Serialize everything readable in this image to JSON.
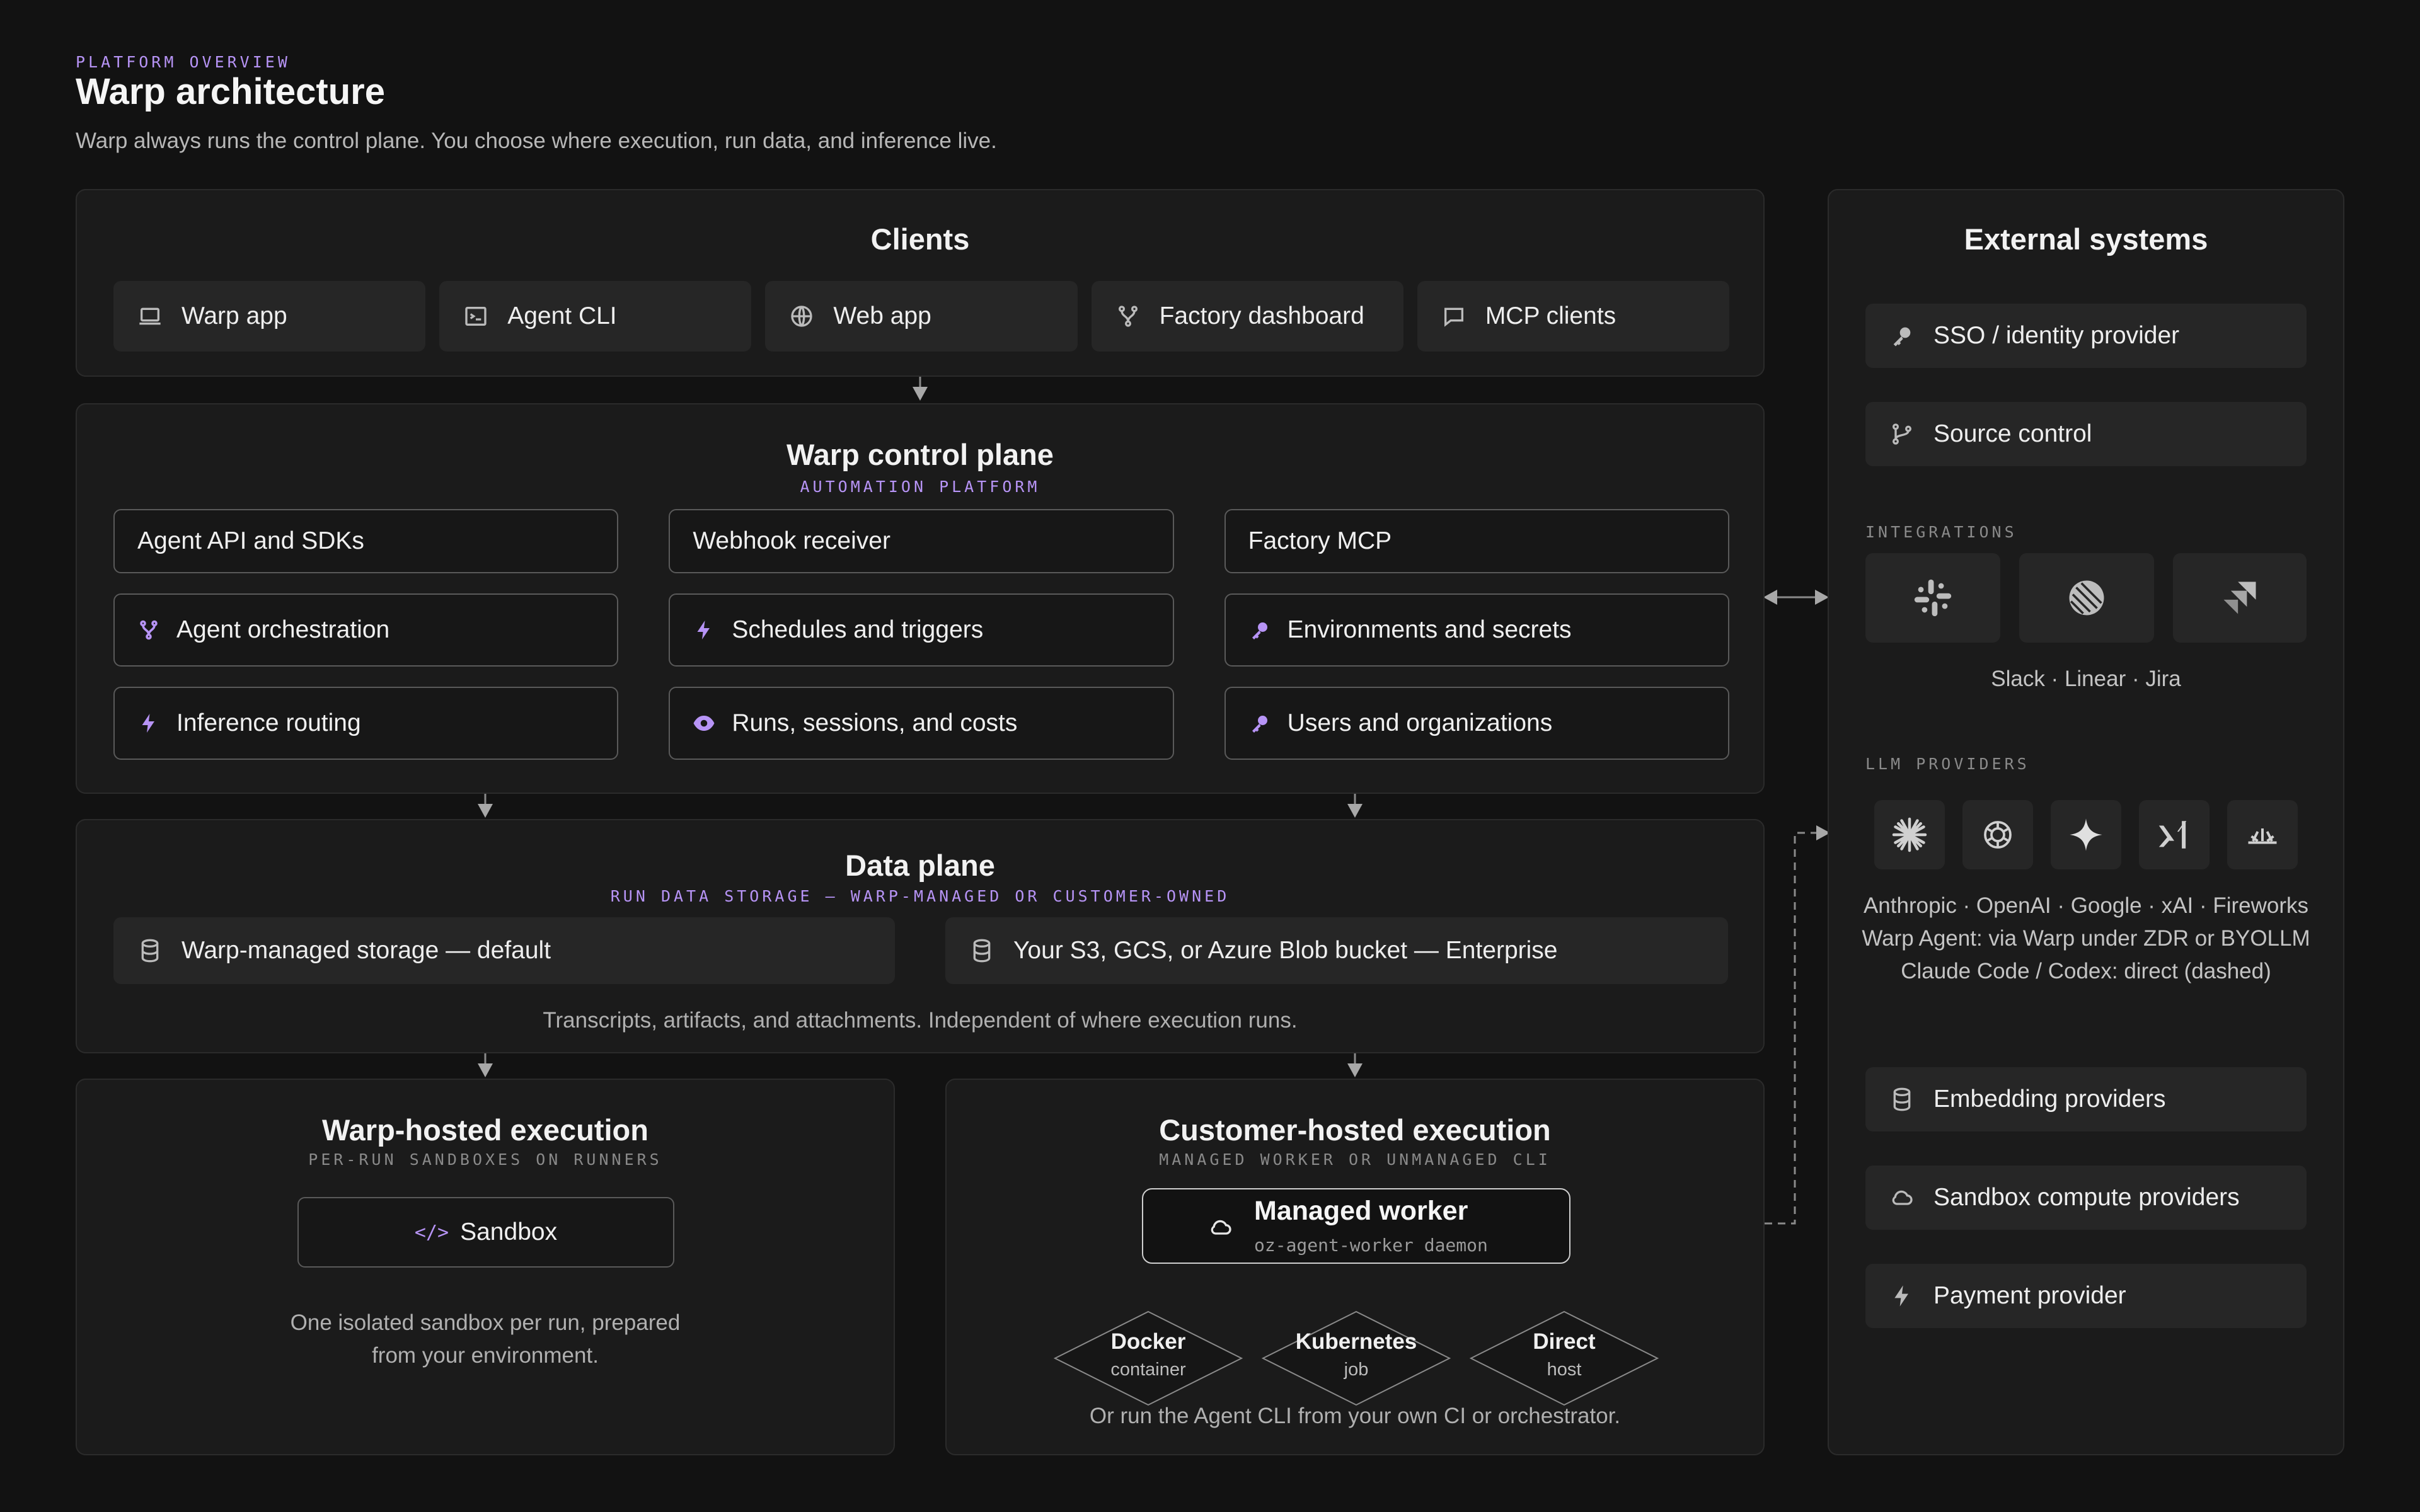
{
  "header": {
    "eyebrow": "PLATFORM OVERVIEW",
    "title": "Warp architecture",
    "subtitle": "Warp always runs the control plane. You choose where execution, run data, and inference live."
  },
  "clients": {
    "title": "Clients",
    "items": [
      {
        "label": "Warp app",
        "icon": "laptop-icon"
      },
      {
        "label": "Agent CLI",
        "icon": "terminal-icon"
      },
      {
        "label": "Web app",
        "icon": "globe-icon"
      },
      {
        "label": "Factory dashboard",
        "icon": "git-fork-icon"
      },
      {
        "label": "MCP clients",
        "icon": "chat-icon"
      }
    ]
  },
  "control_plane": {
    "title": "Warp control plane",
    "subtitle": "AUTOMATION PLATFORM",
    "items": [
      {
        "label": "Agent API and SDKs",
        "icon": ""
      },
      {
        "label": "Webhook receiver",
        "icon": ""
      },
      {
        "label": "Factory MCP",
        "icon": ""
      },
      {
        "label": "Agent orchestration",
        "icon": "git-fork-icon"
      },
      {
        "label": "Schedules and triggers",
        "icon": "bolt-icon"
      },
      {
        "label": "Environments and secrets",
        "icon": "key-icon"
      },
      {
        "label": "Inference routing",
        "icon": "bolt-icon"
      },
      {
        "label": "Runs, sessions, and costs",
        "icon": "eye-icon"
      },
      {
        "label": "Users and organizations",
        "icon": "key-icon"
      }
    ]
  },
  "data_plane": {
    "title": "Data plane",
    "subtitle": "RUN DATA STORAGE — WARP-MANAGED OR CUSTOMER-OWNED",
    "items": [
      {
        "label": "Warp-managed storage — default",
        "icon": "database-icon"
      },
      {
        "label": "Your S3, GCS, or Azure Blob bucket — Enterprise",
        "icon": "database-icon"
      }
    ],
    "note": "Transcripts, artifacts, and attachments. Independent of where execution runs."
  },
  "warp_hosted": {
    "title": "Warp-hosted execution",
    "subtitle": "PER-RUN SANDBOXES ON RUNNERS",
    "sandbox_label": "Sandbox",
    "sandbox_icon": "code-icon",
    "note_line1": "One isolated sandbox per run, prepared",
    "note_line2": "from your environment."
  },
  "customer_hosted": {
    "title": "Customer-hosted execution",
    "subtitle": "MANAGED WORKER OR UNMANAGED CLI",
    "worker_title": "Managed worker",
    "worker_sub": "oz-agent-worker daemon",
    "worker_icon": "cloud-icon",
    "targets": [
      {
        "title": "Docker",
        "sub": "container"
      },
      {
        "title": "Kubernetes",
        "sub": "job"
      },
      {
        "title": "Direct",
        "sub": "host"
      }
    ],
    "note": "Or run the Agent CLI from your own CI or orchestrator."
  },
  "external": {
    "title": "External systems",
    "top_items": [
      {
        "label": "SSO / identity provider",
        "icon": "key-icon"
      },
      {
        "label": "Source control",
        "icon": "git-branch-icon"
      }
    ],
    "integrations_label": "INTEGRATIONS",
    "integrations": [
      {
        "name": "slack-logo-icon"
      },
      {
        "name": "linear-logo-icon"
      },
      {
        "name": "jira-logo-icon"
      }
    ],
    "integrations_caption": "Slack · Linear · Jira",
    "llm_label": "LLM PROVIDERS",
    "llm_providers": [
      {
        "name": "anthropic-logo-icon"
      },
      {
        "name": "openai-logo-icon"
      },
      {
        "name": "google-logo-icon"
      },
      {
        "name": "xai-logo-icon"
      },
      {
        "name": "fireworks-logo-icon"
      }
    ],
    "llm_caption_1": "Anthropic · OpenAI · Google · xAI · Fireworks",
    "llm_caption_2": "Warp Agent: via Warp under ZDR or BYOLLM",
    "llm_caption_3": "Claude Code / Codex: direct (dashed)",
    "bottom_items": [
      {
        "label": "Embedding providers",
        "icon": "database-icon"
      },
      {
        "label": "Sandbox compute providers",
        "icon": "cloud-icon"
      },
      {
        "label": "Payment provider",
        "icon": "bolt-icon"
      }
    ]
  },
  "colors": {
    "background": "#121212",
    "panel": "#1b1b1b",
    "chip": "#262626",
    "accent": "#b794f6",
    "text": "#ececec",
    "muted": "#8a8a8a"
  }
}
